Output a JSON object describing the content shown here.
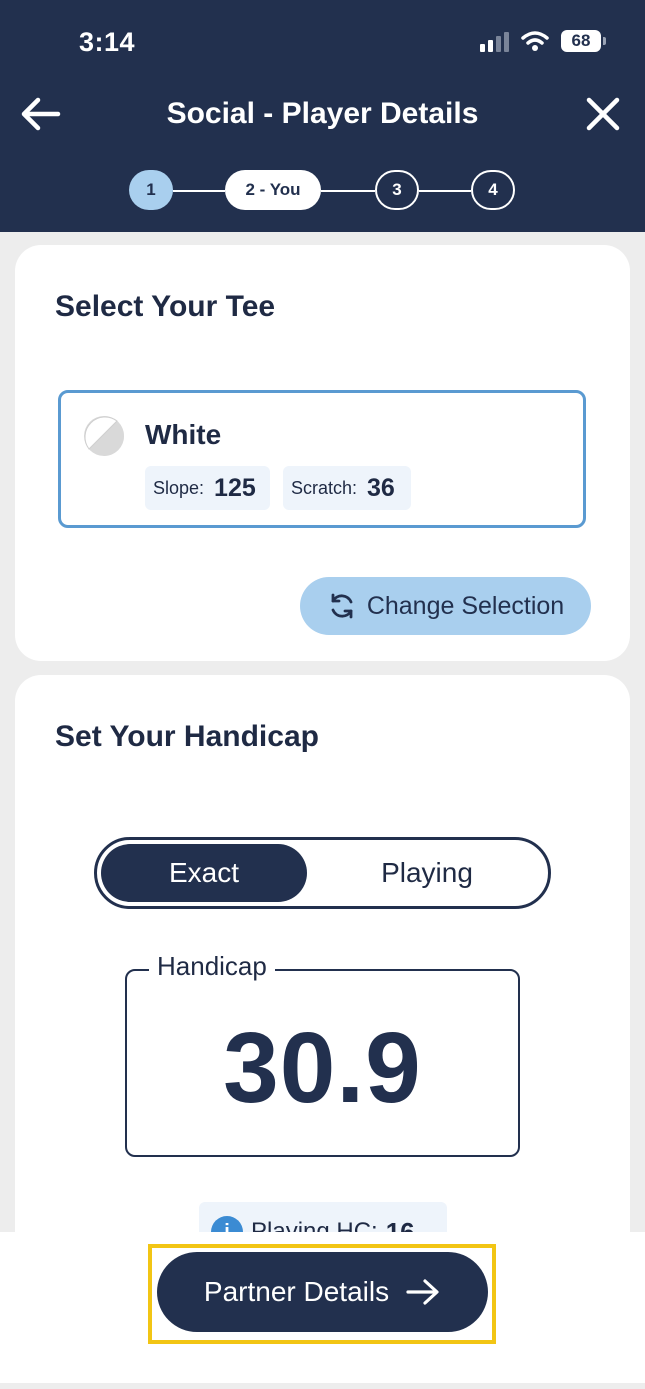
{
  "status_bar": {
    "time": "3:14",
    "battery": "68"
  },
  "header": {
    "title": "Social - Player Details",
    "steps": [
      "1",
      "2 - You",
      "3",
      "4"
    ]
  },
  "tee_card": {
    "title": "Select Your Tee",
    "selected_tee": {
      "name": "White",
      "slope_label": "Slope:",
      "slope": "125",
      "scratch_label": "Scratch:",
      "scratch": "36"
    },
    "change_button": "Change Selection"
  },
  "handicap_card": {
    "title": "Set Your Handicap",
    "toggle": {
      "exact": "Exact",
      "playing": "Playing",
      "selected": "Exact"
    },
    "handicap_label": "Handicap",
    "handicap_value": "30.9",
    "playing_hc_label": "Playing HC:",
    "playing_hc_value": "16"
  },
  "footer": {
    "next_button": "Partner Details"
  },
  "colors": {
    "navy": "#22304e",
    "light_blue": "#a9cfee",
    "tee_border": "#5a9ad1",
    "highlight": "#f2c514"
  },
  "icons": [
    "back-arrow-icon",
    "close-icon",
    "refresh-icon",
    "info-icon",
    "arrow-right-icon",
    "signal-icon",
    "wifi-icon",
    "battery-icon"
  ]
}
